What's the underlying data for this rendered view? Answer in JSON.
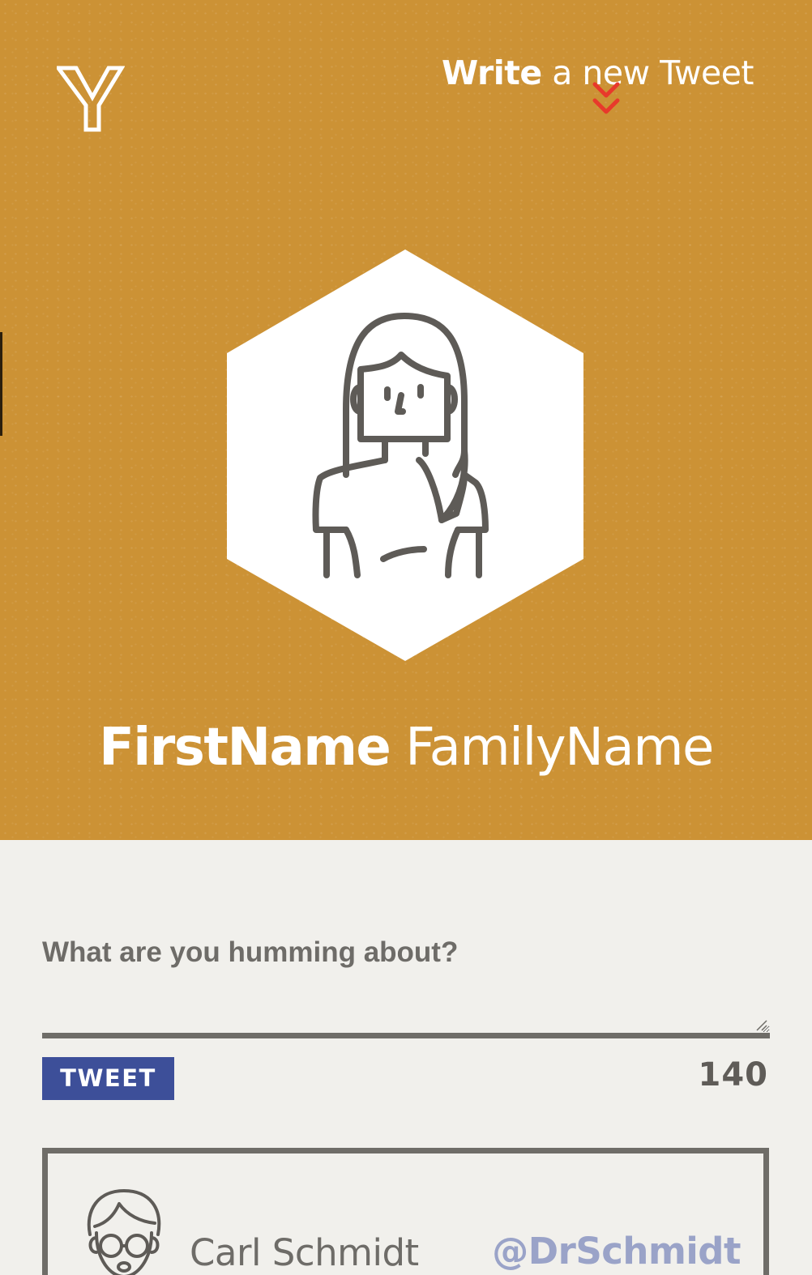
{
  "colors": {
    "header_bg": "#cc9235",
    "page_bg": "#f1f0ec",
    "tweet_button_bg": "#3d4f99",
    "handle_color": "#9aa3c8",
    "text_gray": "#6e6c68",
    "chevron": "#e8392b"
  },
  "header": {
    "logo_icon": "y-logo-icon",
    "write_link": {
      "bold": "Write",
      "rest": " a new Tweet",
      "icon": "double-chevron-down-icon"
    },
    "avatar_icon": "woman-avatar-icon",
    "profile_name": {
      "first": "FirstName",
      "last": "FamilyName"
    }
  },
  "composer": {
    "placeholder": "What are you humming about?",
    "value": "",
    "tweet_label": "TWEET",
    "char_count": "140"
  },
  "feed": [
    {
      "avatar_icon": "man-with-glasses-avatar-icon",
      "name": "Carl Schmidt",
      "handle": "@DrSchmidt"
    }
  ]
}
